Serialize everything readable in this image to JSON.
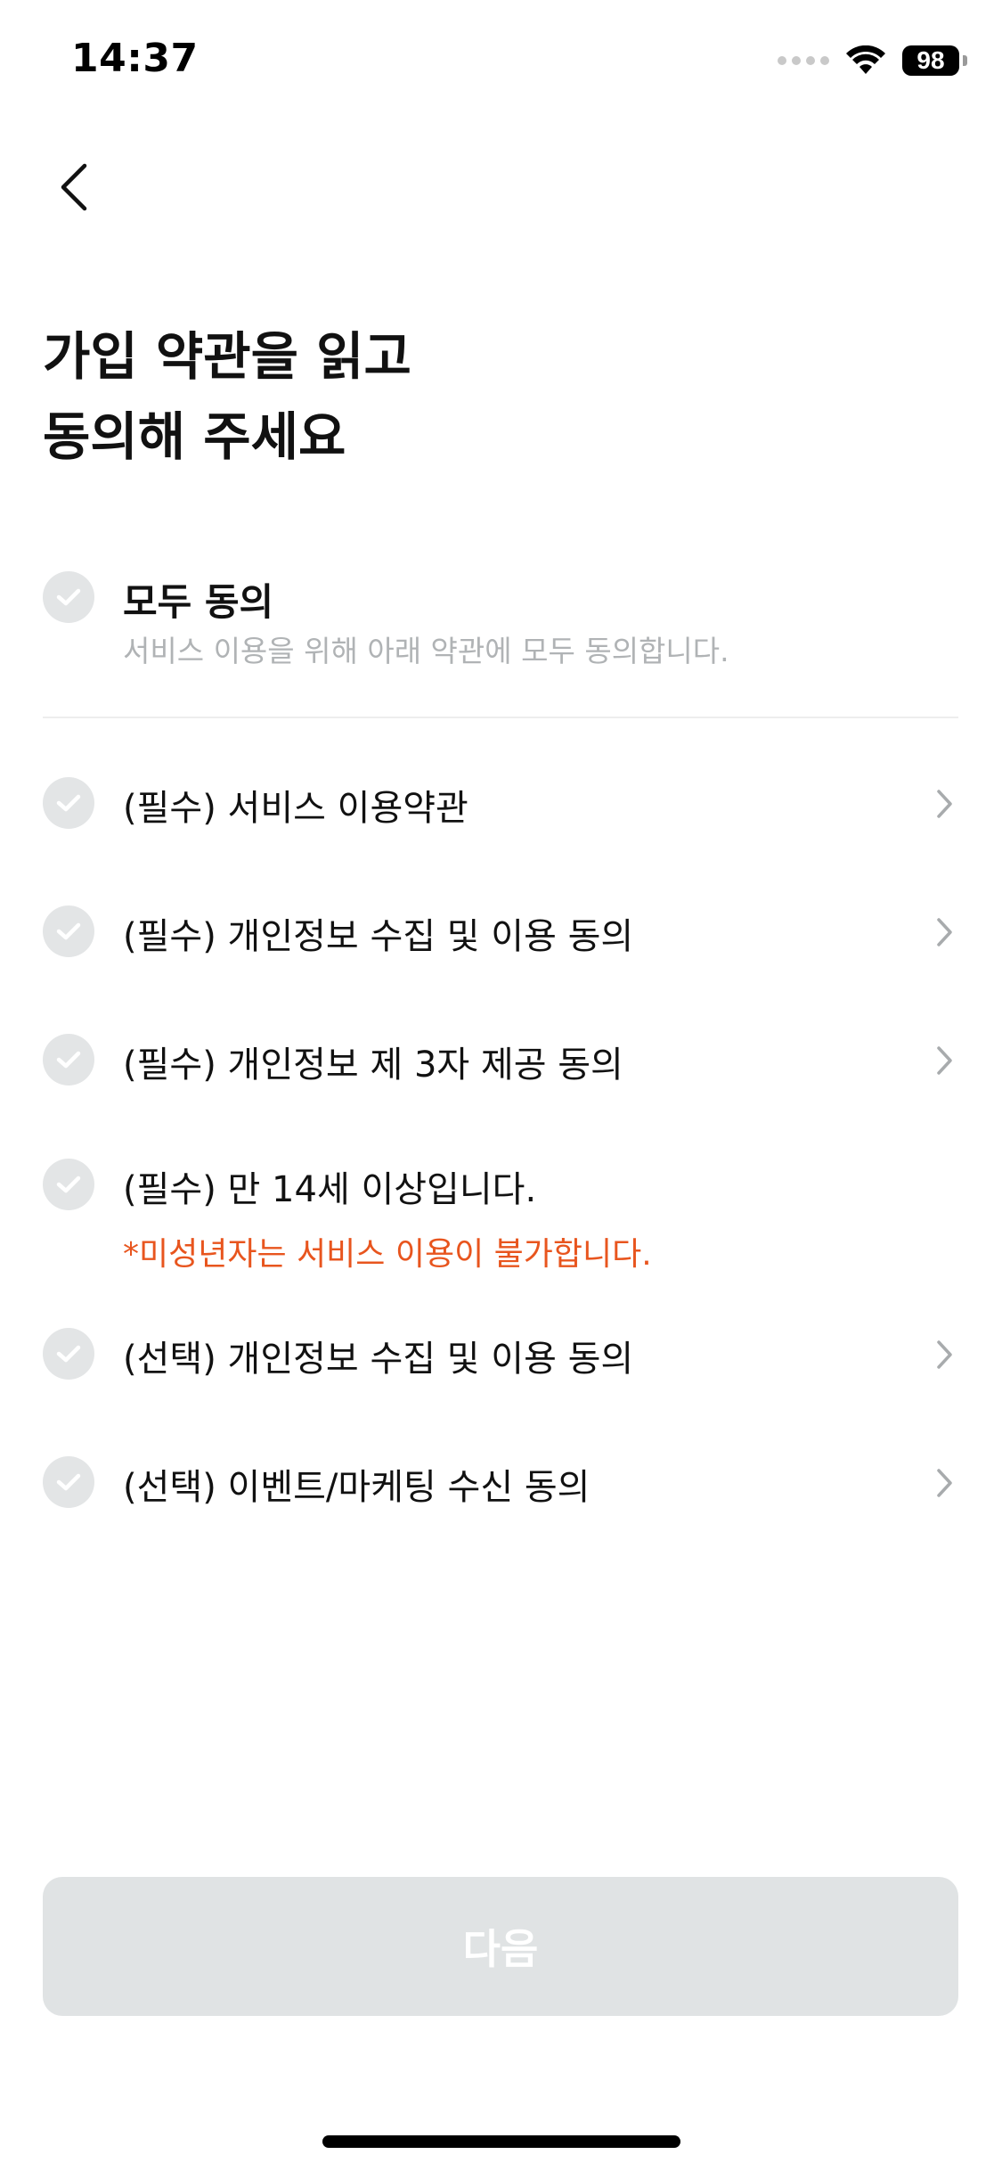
{
  "status_bar": {
    "time": "14:37",
    "battery": "98"
  },
  "header": {
    "title_line1": "가입 약관을 읽고",
    "title_line2": "동의해 주세요"
  },
  "agree_all": {
    "title": "모두 동의",
    "description": "서비스 이용을 위해 아래 약관에 모두 동의합니다."
  },
  "terms": [
    {
      "label": "(필수) 서비스 이용약관"
    },
    {
      "label": "(필수) 개인정보 수집 및 이용 동의"
    },
    {
      "label": "(필수) 개인정보 제 3자 제공 동의"
    },
    {
      "label": "(필수) 만 14세 이상입니다.",
      "note": "*미성년자는 서비스 이용이 불가합니다."
    },
    {
      "label": "(선택) 개인정보 수집 및 이용 동의"
    },
    {
      "label": "(선택) 이벤트/마케팅 수신 동의"
    }
  ],
  "next_button": {
    "label": "다음"
  },
  "colors": {
    "check_inactive": "#e3e5e6",
    "warning": "#e8551e",
    "button_disabled": "#e0e3e4",
    "subtext": "#b0b3b5"
  },
  "icons": {
    "back": "chevron-left-icon",
    "check": "check-icon",
    "chevron": "chevron-right-icon",
    "wifi": "wifi-icon",
    "signal": "signal-icon",
    "battery": "battery-icon"
  }
}
